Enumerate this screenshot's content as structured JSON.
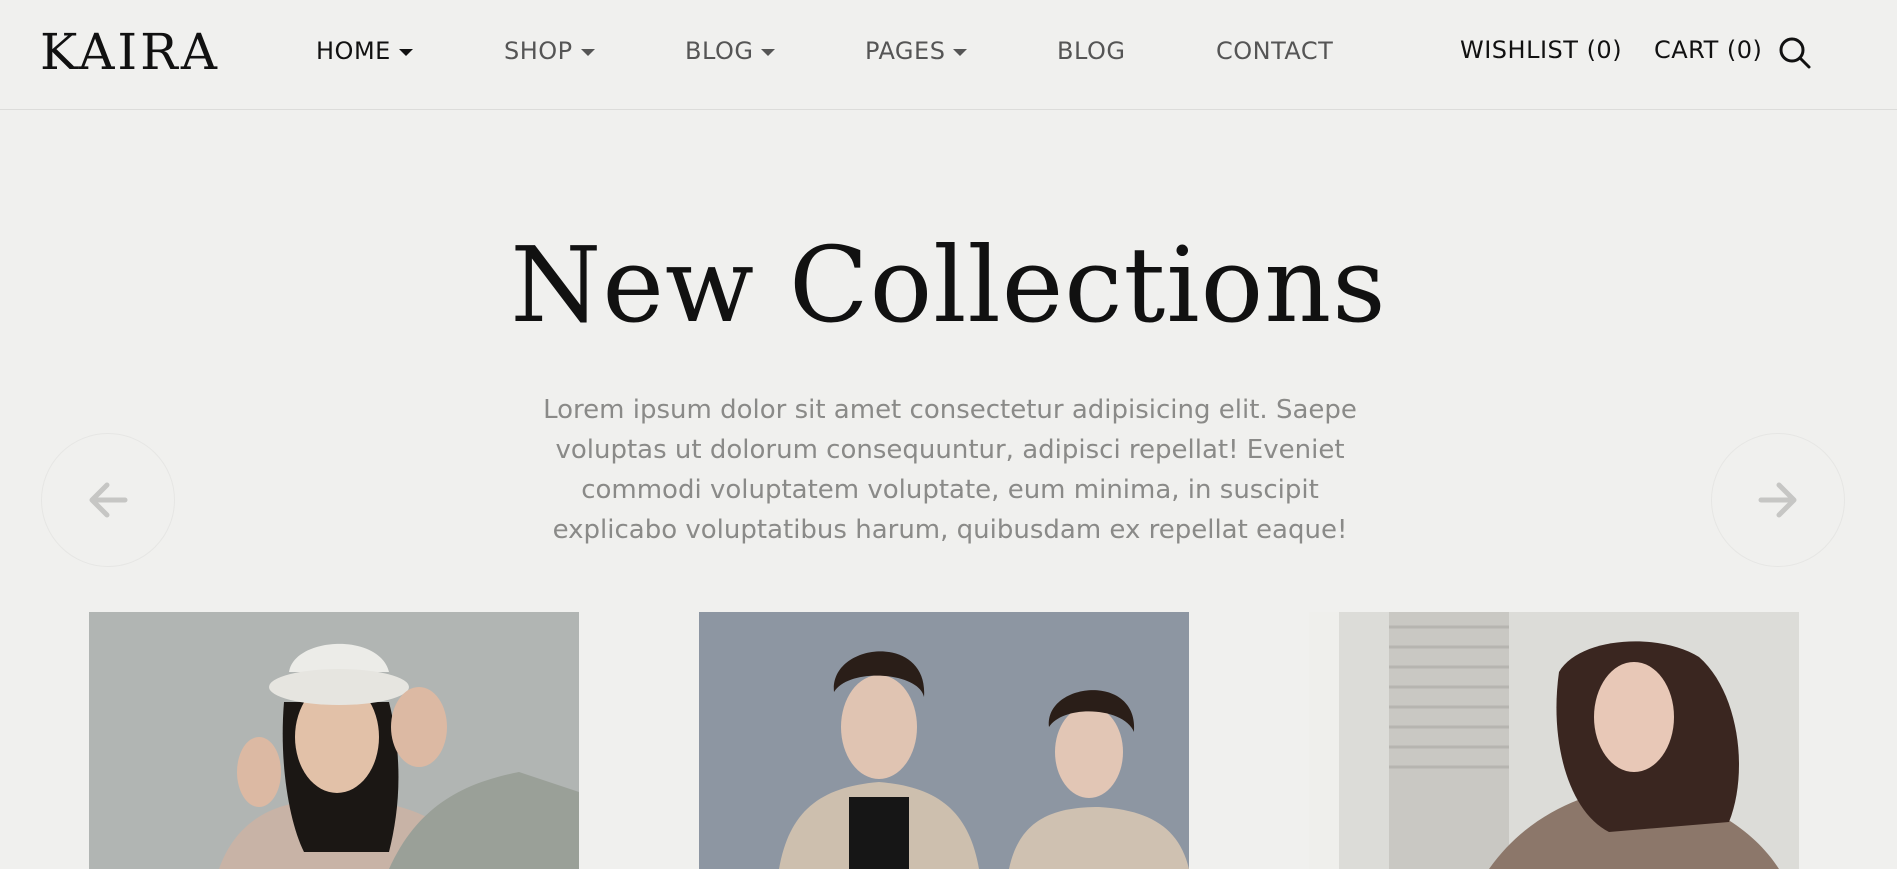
{
  "brand": {
    "name": "KAIRA"
  },
  "nav": {
    "items": [
      {
        "label": "HOME",
        "dropdown": true,
        "active": true
      },
      {
        "label": "SHOP",
        "dropdown": true
      },
      {
        "label": "BLOG",
        "dropdown": true
      },
      {
        "label": "PAGES",
        "dropdown": true
      },
      {
        "label": "BLOG",
        "dropdown": false
      },
      {
        "label": "CONTACT",
        "dropdown": false
      }
    ]
  },
  "utility": {
    "wishlist": "WISHLIST (0)",
    "cart": "CART (0)",
    "search_icon": "search-icon"
  },
  "hero": {
    "title": "New Collections",
    "text": "Lorem ipsum dolor sit amet consectetur adipisicing elit. Saepe voluptas ut dolorum consequuntur, adipisci repellat! Eveniet commodi voluptatem voluptate, eum minima, in suscipit explicabo voluptatibus harum, quibusdam ex repellat eaque!"
  },
  "slider": {
    "prev_icon": "arrow-left-icon",
    "next_icon": "arrow-right-icon"
  },
  "colors": {
    "background": "#f0f0ee",
    "text": "#111111",
    "muted": "#8a8a88"
  }
}
